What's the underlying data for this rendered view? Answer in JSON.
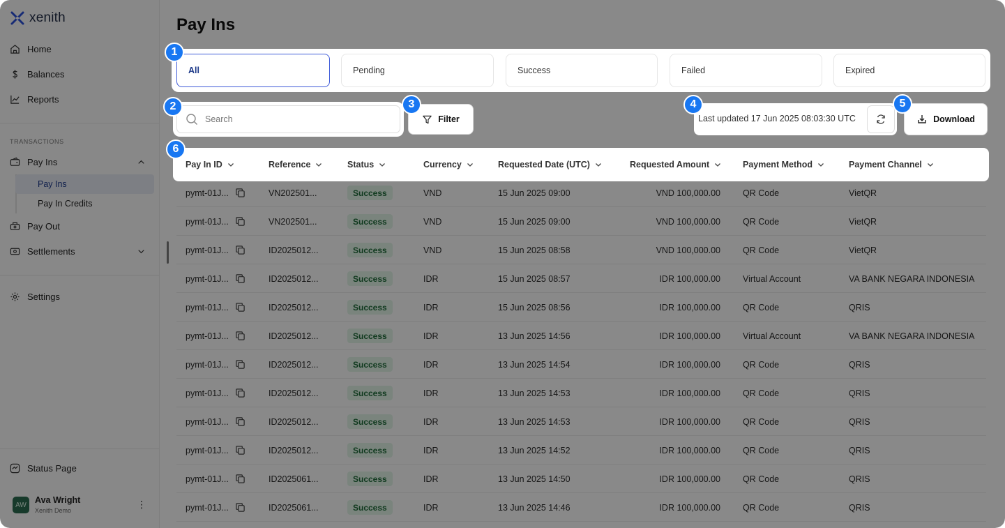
{
  "sidebar": {
    "logo": "xenith",
    "nav_top": [
      {
        "label": "Home",
        "icon": "home-icon"
      },
      {
        "label": "Balances",
        "icon": "dollar-icon"
      },
      {
        "label": "Reports",
        "icon": "chart-icon"
      }
    ],
    "section_label": "TRANSACTIONS",
    "pay_ins": "Pay Ins",
    "sub_items": [
      "Pay Ins",
      "Pay In Credits"
    ],
    "pay_out": "Pay Out",
    "settlements": "Settlements",
    "settings": "Settings",
    "status_page": "Status Page",
    "user": {
      "initials": "AW",
      "name": "Ava Wright",
      "org": "Xenith Demo"
    }
  },
  "page_title": "Pay Ins",
  "tabs": [
    "All",
    "Pending",
    "Success",
    "Failed",
    "Expired"
  ],
  "search_placeholder": "Search",
  "filter_label": "Filter",
  "last_updated": "Last updated 17 Jun 2025 08:03:30 UTC",
  "download_label": "Download",
  "markers": [
    "1",
    "2",
    "3",
    "4",
    "5",
    "6"
  ],
  "columns": [
    "Pay In ID",
    "Reference",
    "Status",
    "Currency",
    "Requested Date (UTC)",
    "Requested Amount",
    "Payment Method",
    "Payment Channel"
  ],
  "rows": [
    {
      "id": "pymt-01J...",
      "ref": "VN202501...",
      "status": "Success",
      "currency": "VND",
      "date": "15 Jun 2025 09:00",
      "amount": "VND 100,000.00",
      "method": "QR Code",
      "channel": "VietQR"
    },
    {
      "id": "pymt-01J...",
      "ref": "VN202501...",
      "status": "Success",
      "currency": "VND",
      "date": "15 Jun 2025 09:00",
      "amount": "VND 100,000.00",
      "method": "QR Code",
      "channel": "VietQR"
    },
    {
      "id": "pymt-01J...",
      "ref": "ID2025012...",
      "status": "Success",
      "currency": "VND",
      "date": "15 Jun 2025 08:58",
      "amount": "VND 100,000.00",
      "method": "QR Code",
      "channel": "VietQR"
    },
    {
      "id": "pymt-01J...",
      "ref": "ID2025012...",
      "status": "Success",
      "currency": "IDR",
      "date": "15 Jun 2025 08:57",
      "amount": "IDR 100,000.00",
      "method": "Virtual Account",
      "channel": "VA BANK NEGARA INDONESIA"
    },
    {
      "id": "pymt-01J...",
      "ref": "ID2025012...",
      "status": "Success",
      "currency": "IDR",
      "date": "15 Jun 2025 08:56",
      "amount": "IDR 100,000.00",
      "method": "QR Code",
      "channel": "QRIS"
    },
    {
      "id": "pymt-01J...",
      "ref": "ID2025012...",
      "status": "Success",
      "currency": "IDR",
      "date": "13 Jun 2025 14:56",
      "amount": "IDR 100,000.00",
      "method": "Virtual Account",
      "channel": "VA BANK NEGARA INDONESIA"
    },
    {
      "id": "pymt-01J...",
      "ref": "ID2025012...",
      "status": "Success",
      "currency": "IDR",
      "date": "13 Jun 2025 14:54",
      "amount": "IDR 100,000.00",
      "method": "QR Code",
      "channel": "QRIS"
    },
    {
      "id": "pymt-01J...",
      "ref": "ID2025012...",
      "status": "Success",
      "currency": "IDR",
      "date": "13 Jun 2025 14:53",
      "amount": "IDR 100,000.00",
      "method": "QR Code",
      "channel": "QRIS"
    },
    {
      "id": "pymt-01J...",
      "ref": "ID2025012...",
      "status": "Success",
      "currency": "IDR",
      "date": "13 Jun 2025 14:53",
      "amount": "IDR 100,000.00",
      "method": "QR Code",
      "channel": "QRIS"
    },
    {
      "id": "pymt-01J...",
      "ref": "ID2025012...",
      "status": "Success",
      "currency": "IDR",
      "date": "13 Jun 2025 14:52",
      "amount": "IDR 100,000.00",
      "method": "QR Code",
      "channel": "QRIS"
    },
    {
      "id": "pymt-01J...",
      "ref": "ID2025061...",
      "status": "Success",
      "currency": "IDR",
      "date": "13 Jun 2025 14:50",
      "amount": "IDR 100,000.00",
      "method": "QR Code",
      "channel": "QRIS"
    },
    {
      "id": "pymt-01J...",
      "ref": "ID2025061...",
      "status": "Success",
      "currency": "IDR",
      "date": "13 Jun 2025 14:46",
      "amount": "IDR 100,000.00",
      "method": "QR Code",
      "channel": "QRIS"
    }
  ],
  "colors": {
    "accent": "#1877f2",
    "active_tab": "#3f5bd9",
    "success_bg": "#dff1e4",
    "success_text": "#1f6b3a"
  }
}
